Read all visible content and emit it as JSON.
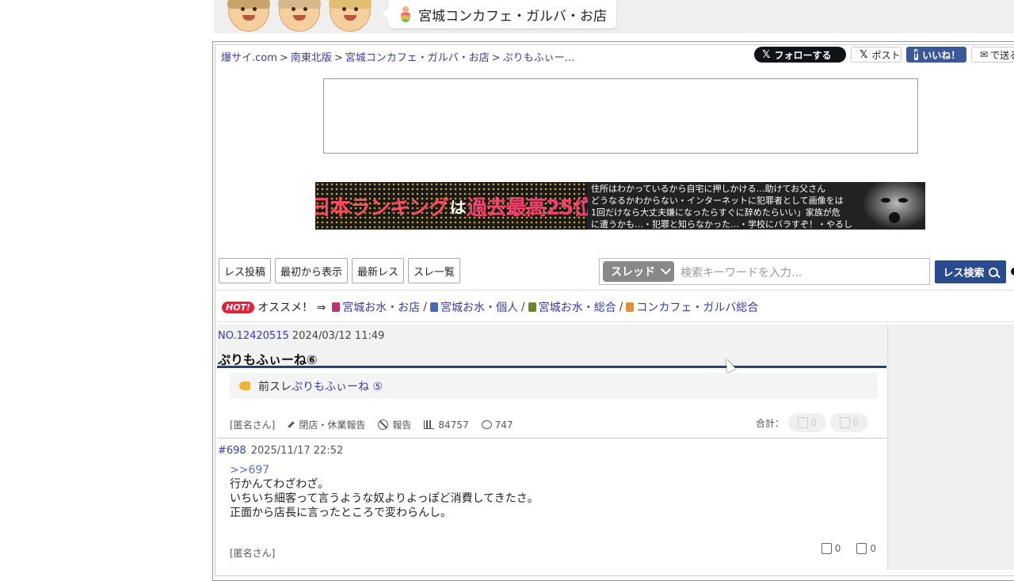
{
  "header": {
    "category_title": "宮城コンカフェ・ガルバ・お店"
  },
  "breadcrumb": [
    "爆サイ.com",
    "南東北版",
    "宮城コンカフェ・ガルバ・お店",
    "ぷりもふぃー…"
  ],
  "social": {
    "x_follow": "フォローする",
    "x_post": "ポスト",
    "fb_like": "いいね！",
    "mail_send": "で送る"
  },
  "banner": {
    "left_text_a": "日本ランキング",
    "left_text_b": "は",
    "left_text_c": "過去最高25位",
    "right_lines": [
      "住所はわかっているから自宅に押しかける…助けてお父さん",
      "どうなるかわからない・インターネットに犯罪者として画像をは",
      "1回だけなら大丈夫嫌になったらすぐに辞めたらいい」家族が危",
      "に遭うかも…・犯罪と知らなかった…・学校にバラすぞ！・やるし"
    ]
  },
  "actions": [
    "レス投稿",
    "最初から表示",
    "最新レス",
    "スレ一覧"
  ],
  "search": {
    "select_value": "スレッド",
    "placeholder": "検索キーワードを入力...",
    "button_label": "レス検索"
  },
  "hot": {
    "badge": "HOT!",
    "label": "オススメ！ ⇒",
    "links": [
      {
        "label": "宮城お水・お店",
        "color": "#c0306a"
      },
      {
        "label": "宮城お水・個人",
        "color": "#4a67b8"
      },
      {
        "label": "宮城お水・総合",
        "color": "#6a8a2a"
      },
      {
        "label": "コンカフェ・ガルバ総合",
        "color": "#e0903a"
      }
    ]
  },
  "thread": {
    "number": "NO.12420515",
    "datetime": "2024/03/12 11:49",
    "title": "ぷりもふぃーね⑥",
    "prev_label": "前スレ",
    "prev_link": "ぷりもふぃーね ⑤",
    "author": "[匿名さん]",
    "closed_report": "閉店・休業報告",
    "report": "報告",
    "views": "84757",
    "comments": "747",
    "total_label": "合計：",
    "total_up": "0",
    "total_down": "0"
  },
  "post": {
    "number": "#698",
    "datetime": "2025/11/17 22:52",
    "reply": ">>697",
    "lines": [
      "行かんてわざわざ。",
      "いちいち細客って言うような奴よりよっぽど消費してきたさ。",
      "正面から店長に言ったところで変わらんし。"
    ],
    "author": "[匿名さん]",
    "up": "0",
    "down": "0"
  }
}
